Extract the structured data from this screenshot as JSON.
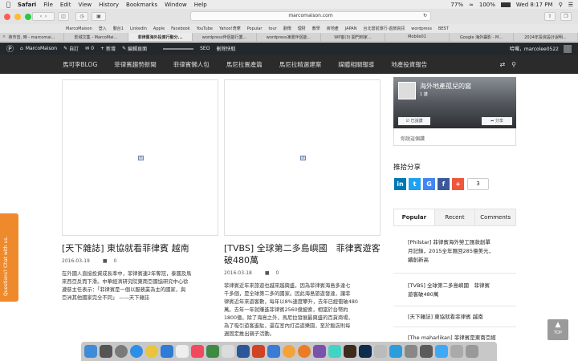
{
  "menubar": {
    "apple": "",
    "app": "Safari",
    "items": [
      "File",
      "Edit",
      "View",
      "History",
      "Bookmarks",
      "Window",
      "Help"
    ],
    "battery": "100%",
    "wifi_pct": "77%",
    "clock": "Wed 8:17 PM"
  },
  "browser": {
    "url": "marcomaison.com",
    "bookmarks": [
      "MarcoMaison",
      "登入",
      "動台1",
      "LinkedIn",
      "Apple",
      "Facebook",
      "YouTube",
      "Yahoo!奇摩",
      "Popular",
      "tour",
      "劃傳",
      "理財",
      "教學",
      "房地產",
      "JAPAN",
      "台北當前旅行-遊旅資訊",
      "wordpress",
      "BEST"
    ],
    "tabs": [
      "夜市音, 時 - marcomai...",
      "影城文集 - MarcoMai...",
      "菲律賓海外投資行動分...",
      "wordpress伴侶能行業...",
      "wordpress凍書伴侶能...",
      "WP客(3) 開門到家...",
      "Mobile01",
      "Google 海外攝影 - M...",
      "2024年投資設計說明..."
    ],
    "active_tab": 2
  },
  "wp_admin": {
    "items": [
      "MarcoMaison",
      "自訂",
      "0",
      "新增",
      "編輯頁面",
      "SEO",
      "刪除快取"
    ],
    "greeting": "哈囉，marcolee0522"
  },
  "site_nav": {
    "items": [
      "馬可李BLOG",
      "菲律賓趨勢新聞",
      "菲律賓懶人包",
      "馬尼拉置產篇",
      "馬尼拉精選建案",
      "媒體相關報導",
      "地產投資報告"
    ]
  },
  "posts": [
    {
      "title": "[天下雜誌] 東協就看菲律賓 越南",
      "date": "2016-03-19",
      "comments": "0",
      "excerpt": [
        "在外國人直接投資成長率中，菲律賓連2年奪冠，泰國及馬",
        "來西亞反而下滑。中華經濟研究院東南亞國協研究中心徐",
        "遵慈主任表示：「菲律賓是一個以服務業為主的國家，與",
        "亞洲其他國家完全不同」 ——天下雜誌"
      ]
    },
    {
      "title": "[TVBS] 全球第二多島嶼國　菲律賓遊客破480萬",
      "date": "2016-03-18",
      "comments": "0",
      "excerpt": [
        "菲律賓近年來旅遊也越來越興盛，因為菲律賓海島多達七",
        "千多個，是全球第二多的國家。因此海島旅遊發達，讓菲",
        "律賓近年來遊客數，每年以8%速度攀升，去年已經衝破480",
        "萬。去年一年就賺進菲律賓2560億披索，相當於台幣約",
        "1800億。除了海島之外，馬尼拉發展最興盛的百貨商場，",
        "為了吸引遊客進駐，還在室內打造遊樂園，至於飯店則每",
        "週固定推出親子活動。"
      ]
    }
  ],
  "sidebar": {
    "fb_page_name": "海外地產孤兒的窩",
    "fb_likes": "1 讚",
    "fb_liked": "已說讚",
    "fb_share": "分享",
    "fb_friend_text": "你說這個讚",
    "share_title": "推拾分享",
    "share_buttons": [
      "in",
      "t",
      "G",
      "f",
      "+"
    ],
    "share_count": "3",
    "widget_tabs": [
      "Popular",
      "Recent",
      "Comments"
    ],
    "popular_posts": [
      [
        "[Philstar] 菲律賓海外勞工匯款創單",
        "月記錄，2015全年匯回285億美元，",
        "續創新高"
      ],
      [
        "[TVBS] 全球第二多島嶼國　菲律賓",
        "遊客破480萬"
      ],
      [
        "[天下雜誌] 東協就看菲律賓 越南"
      ],
      [
        "[The maharlikan] 菲律賓是東南亞經"
      ]
    ]
  },
  "feedback_label": "Questions? Chat with us.",
  "top_label": "TOP",
  "colors": {
    "wp_bar": "#23282d",
    "nav": "#2b2b2b",
    "feedback": "#ef8a2c",
    "fb_blue": "#365899"
  }
}
